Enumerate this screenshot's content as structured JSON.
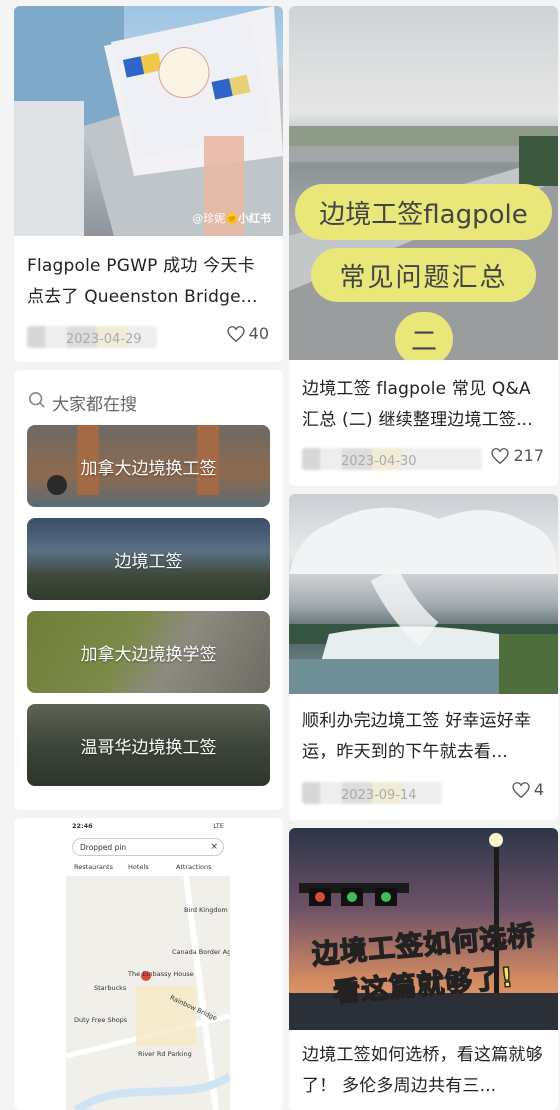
{
  "posts": {
    "p1": {
      "title": "Flagpole PGWP 成功 今天卡点去了 Queenston Bridge...",
      "date": "2023-04-29",
      "likes": "40",
      "tag": "小红书",
      "user_tag": "@珍妮🌞"
    },
    "p2": {
      "title": "边境工签 flagpole 常见 Q&A 汇总 (二) 继续整理边境工签...",
      "date": "2023-04-30",
      "likes": "217",
      "overlay": {
        "line1": "边境工签flagpole",
        "line2": "常见问题汇总",
        "line3": "二"
      }
    },
    "p3": {
      "title": "顺利办完边境工签 好幸运好幸运，昨天到的下午就去看...",
      "date": "2023-09-14",
      "likes": "4"
    },
    "p4": {
      "title": "边境工签如何选桥，看这篇就够了！ 多伦多周边共有三...",
      "overlay": {
        "line1": "边境工签如何选桥",
        "line2": "看这篇就够了!"
      }
    },
    "p5": {
      "map": {
        "time": "22:46",
        "signal": "LTE",
        "pin_label": "Dropped pin",
        "filters": [
          "Restaurants",
          "Hotels",
          "Attractions"
        ],
        "places": [
          "Starbucks",
          "Rainbow Bridge",
          "River Rd Parking",
          "Canada Border Agency - Rai",
          "Bird Kingdom",
          "The Embassy House",
          "Duty Free Shops"
        ]
      }
    }
  },
  "search": {
    "header": "大家都在搜",
    "chips": [
      "加拿大边境换工签",
      "边境工签",
      "加拿大边境换学签",
      "温哥华边境换工签"
    ]
  }
}
